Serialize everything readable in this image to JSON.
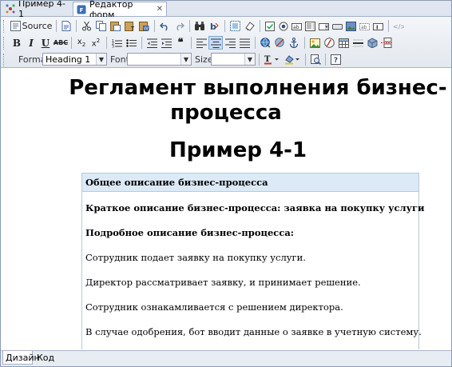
{
  "tabs": [
    {
      "label": "Пример 4-1",
      "icon": "process-icon"
    },
    {
      "label": "Редактор форм",
      "icon": "form-editor-icon"
    }
  ],
  "toolbar": {
    "source_label": "Source",
    "format_label": "Format",
    "format_value": "Heading 1",
    "font_label": "Font",
    "font_value": "",
    "size_label": "Size",
    "size_value": ""
  },
  "document": {
    "title_line1": "Регламент выполнения бизнес-",
    "title_line2": "процесса",
    "subtitle": "Пример 4-1",
    "section_header": "Общее описание бизнес-процесса",
    "paragraphs": [
      "Краткое описание бизнес-процесса: заявка на покупку услуги",
      "Подробное описание бизнес-процесса:",
      "Сотрудник подает заявку на покупку услуги.",
      "Директор рассматривает заявку, и принимает решение.",
      "Сотрудник ознакамливается с решением директора.",
      "В случае одобрения, бот вводит данные о заявке в учетную систему."
    ]
  },
  "bottom_tabs": [
    "Дизайн",
    "Код"
  ]
}
